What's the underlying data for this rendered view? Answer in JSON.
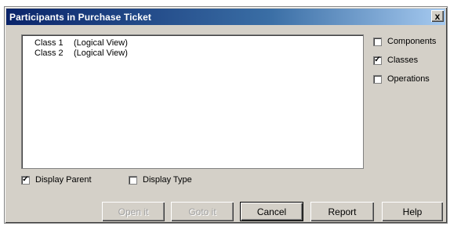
{
  "window": {
    "title": "Participants in Purchase Ticket",
    "close_glyph": "x"
  },
  "participants": {
    "items": [
      {
        "name": "Class 1",
        "view": "(Logical View)"
      },
      {
        "name": "Class 2",
        "view": "(Logical View)"
      }
    ]
  },
  "filters": {
    "components": {
      "label": "Components",
      "checked": false
    },
    "classes": {
      "label": "Classes",
      "checked": true
    },
    "operations": {
      "label": "Operations",
      "checked": false
    }
  },
  "options": {
    "display_parent": {
      "label": "Display Parent",
      "checked": true
    },
    "display_type": {
      "label": "Display Type",
      "checked": false
    }
  },
  "buttons": {
    "open": {
      "label": "Open it",
      "enabled": false
    },
    "goto": {
      "label": "Goto it",
      "enabled": false
    },
    "cancel": {
      "label": "Cancel",
      "enabled": true
    },
    "report": {
      "label": "Report",
      "enabled": true
    },
    "help": {
      "label": "Help",
      "enabled": true
    }
  },
  "check_glyph": "✓"
}
